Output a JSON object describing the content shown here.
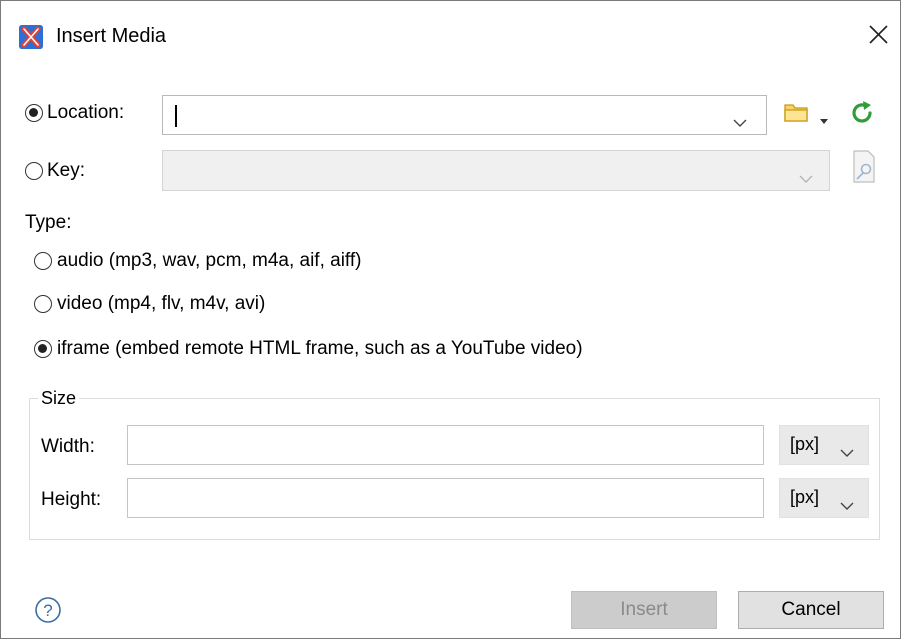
{
  "dialog": {
    "title": "Insert Media"
  },
  "source": {
    "location_label": "Location:",
    "location_value": "",
    "location_selected": true,
    "key_label": "Key:",
    "key_value": "",
    "key_selected": false
  },
  "type": {
    "heading": "Type:",
    "options": [
      {
        "label": "audio (mp3, wav, pcm, m4a, aif, aiff)",
        "selected": false
      },
      {
        "label": "video (mp4, flv, m4v, avi)",
        "selected": false
      },
      {
        "label": "iframe (embed remote HTML frame, such as a YouTube video)",
        "selected": true
      }
    ]
  },
  "size": {
    "legend": "Size",
    "width_label": "Width:",
    "width_value": "",
    "width_unit": "[px]",
    "height_label": "Height:",
    "height_value": "",
    "height_unit": "[px]"
  },
  "buttons": {
    "insert": "Insert",
    "cancel": "Cancel"
  },
  "icons": {
    "app": "oxygen-x-icon",
    "close": "close-icon",
    "folder": "folder-icon",
    "refresh": "refresh-icon",
    "key_lookup": "key-lookup-icon",
    "help": "help-icon"
  },
  "colors": {
    "folder": "#e6b422",
    "refresh": "#2e9e3a",
    "app_icon_bg": "#2f6fd3",
    "app_icon_x": "#e8402f"
  }
}
